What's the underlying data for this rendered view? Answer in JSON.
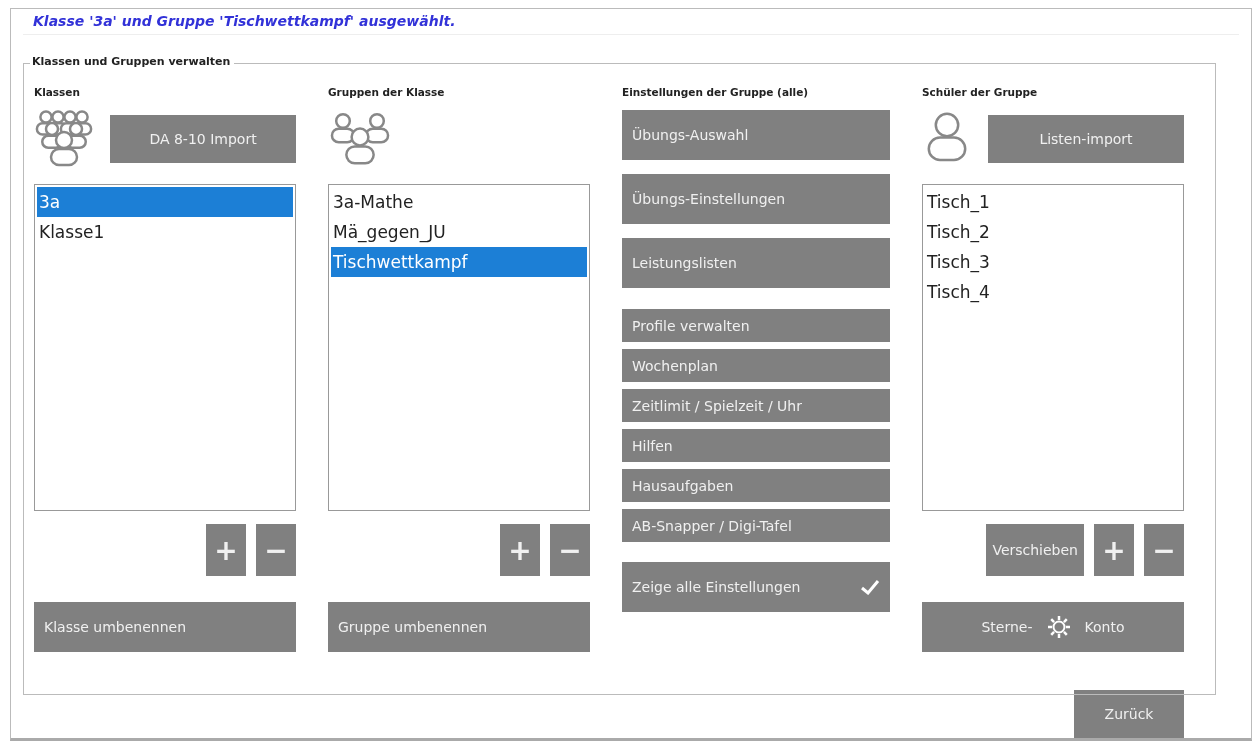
{
  "status_message": "Klasse '3a' und Gruppe 'Tischwettkampf' ausgewählt.",
  "group_box": {
    "title": "Klassen und Gruppen verwalten"
  },
  "classes": {
    "heading": "Klassen",
    "import_button": "DA 8-10 Import",
    "items": [
      {
        "label": "3a",
        "selected": true
      },
      {
        "label": "Klasse1",
        "selected": false
      }
    ],
    "add_button": "+",
    "remove_button": "−",
    "rename_button": "Klasse umbenennen"
  },
  "groups": {
    "heading": "Gruppen der Klasse",
    "items": [
      {
        "label": "3a-Mathe",
        "selected": false
      },
      {
        "label": "Mä_gegen_JU",
        "selected": false
      },
      {
        "label": "Tischwettkampf",
        "selected": true
      }
    ],
    "add_button": "+",
    "remove_button": "−",
    "rename_button": "Gruppe umbenennen"
  },
  "settings": {
    "heading": "Einstellungen der Gruppe (alle)",
    "buttons": [
      {
        "label": "Übungs-Auswahl",
        "kind": "large"
      },
      {
        "label": "Übungs-Einstellungen",
        "kind": "large"
      },
      {
        "label": "Leistungslisten",
        "kind": "large"
      },
      {
        "label": "Profile verwalten",
        "kind": "small"
      },
      {
        "label": "Wochenplan",
        "kind": "small"
      },
      {
        "label": "Zeitlimit / Spielzeit / Uhr",
        "kind": "small"
      },
      {
        "label": "Hilfen",
        "kind": "small"
      },
      {
        "label": "Hausaufgaben",
        "kind": "small"
      },
      {
        "label": "AB-Snapper / Digi-Tafel",
        "kind": "small"
      }
    ],
    "show_all": {
      "label": "Zeige alle Einstellungen",
      "checked": true
    }
  },
  "students": {
    "heading": "Schüler der Gruppe",
    "import_button": "Listen-import",
    "items": [
      {
        "label": "Tisch_1",
        "selected": false
      },
      {
        "label": "Tisch_2",
        "selected": false
      },
      {
        "label": "Tisch_3",
        "selected": false
      },
      {
        "label": "Tisch_4",
        "selected": false
      }
    ],
    "move_button": "Verschieben",
    "add_button": "+",
    "remove_button": "−",
    "stars_button": {
      "left": "Sterne-",
      "right": "Konto"
    }
  },
  "back_button": "Zurück"
}
